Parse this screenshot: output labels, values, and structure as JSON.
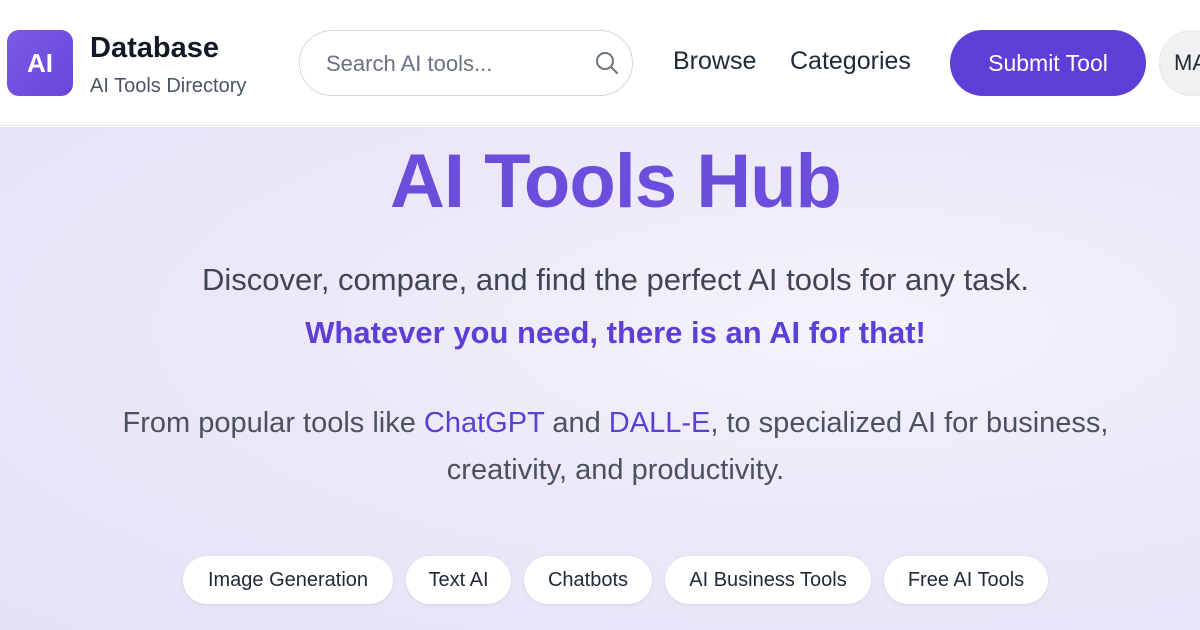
{
  "header": {
    "logo_text": "AI",
    "brand_name": "Database",
    "brand_subtitle": "AI Tools Directory",
    "search": {
      "placeholder": "Search AI tools...",
      "value": ""
    },
    "nav": {
      "browse": "Browse",
      "categories": "Categories"
    },
    "submit_label": "Submit Tool",
    "avatar_initials": "MA"
  },
  "hero": {
    "title": "AI Tools Hub",
    "tagline": "Discover, compare, and find the perfect AI tools for any task.",
    "highlight": "Whatever you need, there is an AI for that!",
    "desc": {
      "prefix": "From popular tools like ",
      "link1": "ChatGPT",
      "middle": " and ",
      "link2": "DALL-E",
      "suffix": ", to specialized AI for business, creativity, and productivity."
    },
    "chips": [
      "Image Generation",
      "Text AI",
      "Chatbots",
      "AI Business Tools",
      "Free AI Tools"
    ]
  },
  "colors": {
    "accent": "#5b3fd6",
    "title": "#6a4fdc",
    "text": "#3f4555"
  },
  "icons": {
    "search": "search-icon"
  }
}
